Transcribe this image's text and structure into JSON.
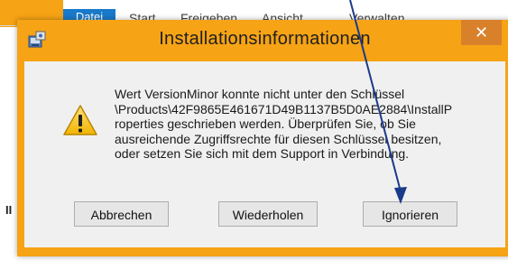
{
  "background_window": {
    "tabs": [
      "Datei",
      "Start",
      "Freigeben",
      "Ansicht",
      "Verwalten"
    ],
    "fragment": "II"
  },
  "dialog": {
    "title": "Installationsinformationen",
    "close_label": "✕",
    "message": "Wert VersionMinor konnte nicht unter den Schlüssel\n\\Products\\42F9865E461671D49B1137B5D0AE2884\\InstallP\nroperties geschrieben werden. Überprüfen Sie, ob Sie\nausreichende Zugriffsrechte für diesen Schlüssel besitzen,\noder setzen Sie sich mit dem Support in Verbindung.",
    "buttons": {
      "abort": "Abbrechen",
      "retry": "Wiederholen",
      "ignore": "Ignorieren"
    },
    "icons": {
      "app": "installer-icon",
      "warning": "warning-icon",
      "close": "close-icon"
    }
  },
  "colors": {
    "title_bar": "#f6a315",
    "accent_tab": "#1979ca",
    "arrow": "#1a3a8a"
  }
}
